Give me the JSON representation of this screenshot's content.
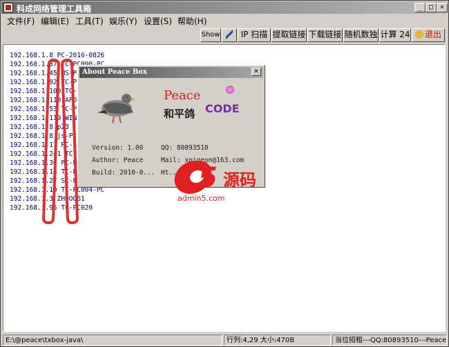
{
  "window": {
    "title": "科成网络管理工具箱"
  },
  "menu": [
    "文件(F)",
    "编辑(E)",
    "工具(T)",
    "娱乐(Y)",
    "设置(S)",
    "帮助(H)"
  ],
  "toolbar": {
    "show": "Show",
    "ip_scan": "IP 扫描",
    "extract_links": "提取链接",
    "download_links": "下载链接",
    "sudoku": "随机数独",
    "calc": "计算 24",
    "exit": "退出"
  },
  "lines": [
    "192.168.1.8  PC-2016-0826",
    "192.168.1.37 TC-PC090-PC",
    "192.168.1.45 MS-PC006",
    "192.168.1.92 TC-PC008",
    "192.168.1.100 TC-PC010",
    "192.168.1.110 AFOR-PC",
    "192.168.1.53 TC-PC018",
    "192.168.1.119 WIN-NS",
    "192.168.1.8  p23",
    "192.168.1.8  js-PC",
    "192.168.1.17 PC-S-DC",
    "192.168.1.241 TC-PC001",
    "192.168.1.30 PC-PC002",
    "192.168.1.18 TC-PC003",
    "192.168.1.27 SC-PC100-BILL",
    "192.168.1.10 TC-PC004-PC",
    "192.168.1.3  ZHDOG61",
    "192.168.1.95 TC-PC020"
  ],
  "status": {
    "path": "E:\\@peace\\txbox-java\\",
    "position": "行列:4,29 大小:470B",
    "info": "当位招租---QQ:80893510---Peace"
  },
  "dialog": {
    "title": "About Peace Box",
    "logo_en": "Peace",
    "logo_cn": "和平鸽",
    "logo_code": "CODE",
    "version": "Version: 1.00",
    "qq": "QQ: 80893510",
    "author": "Author: Peace",
    "mail": "Mail: xpigeon@163.com",
    "build": "Build: 2010-0...",
    "http": "Ht..."
  },
  "watermark": {
    "brand_cn": "源码",
    "url": "admin5.com",
    "digit": "5"
  }
}
